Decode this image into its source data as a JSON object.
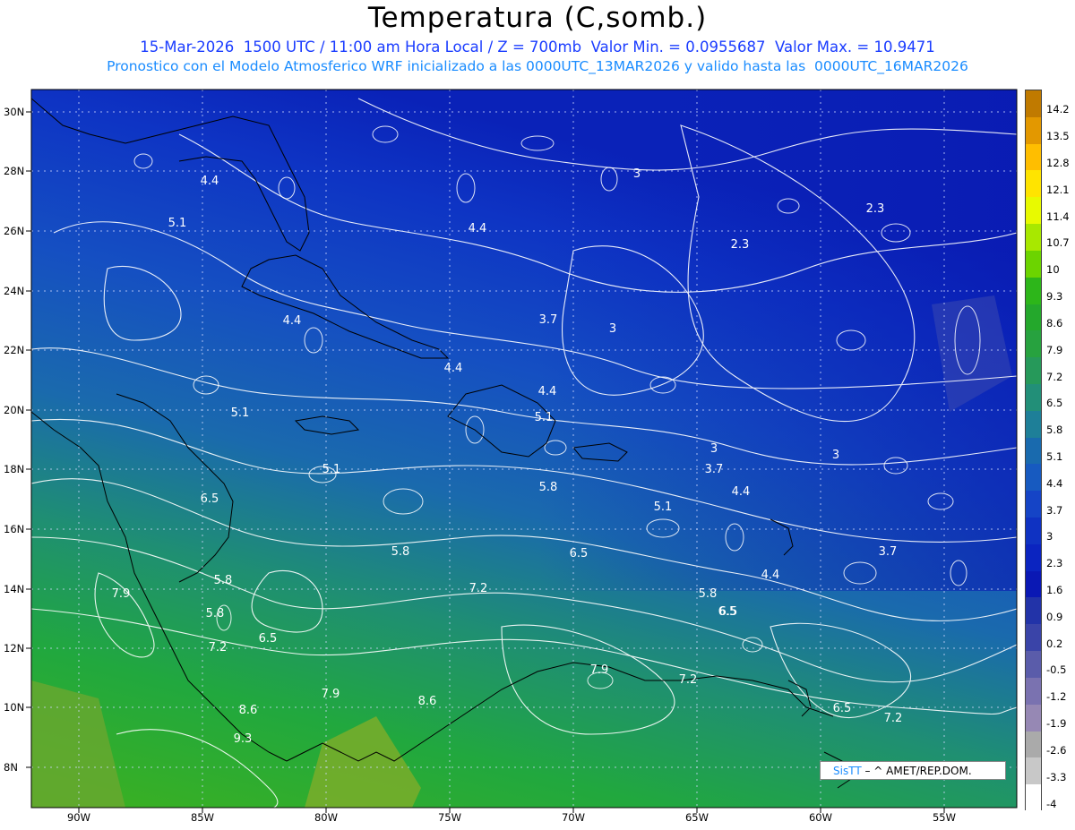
{
  "header": {
    "title": "Temperatura (C,somb.)",
    "subtitle_line1": "15-Mar-2026  1500 UTC / 11:00 am Hora Local / Z = 700mb  Valor Min. = 0.0955687  Valor Max. = 10.9471",
    "subtitle_line2": "Pronostico con el Modelo Atmosferico WRF inicializado a las 0000UTC_13MAR2026 y valido hasta las  0000UTC_16MAR2026"
  },
  "map": {
    "variable": "Temperatura",
    "units": "C",
    "level": "700mb",
    "valid_time": "15-Mar-2026 1500 UTC",
    "value_min": 0.0955687,
    "value_max": 10.9471,
    "lon_range": [
      -92.0,
      -52.5
    ],
    "lat_range": [
      6.8,
      30.5
    ],
    "lat_ticks": [
      "30N",
      "28N",
      "26N",
      "24N",
      "22N",
      "20N",
      "18N",
      "16N",
      "14N",
      "12N",
      "10N",
      "8N"
    ],
    "lon_ticks": [
      "90W",
      "85W",
      "80W",
      "75W",
      "70W",
      "65W",
      "60W",
      "55W"
    ],
    "contour_labels": [
      "4.4",
      "5.1",
      "4.4",
      "3",
      "2.3",
      "2.3",
      "4.4",
      "3.7",
      "3",
      "4.4",
      "4.4",
      "5.1",
      "5.1",
      "5.1",
      "3",
      "3.7",
      "4.4",
      "5.8",
      "6.5",
      "5.1",
      "3",
      "6.5",
      "5.8",
      "5.8",
      "6.5",
      "3.7",
      "4.4",
      "5.8",
      "7.9",
      "7.2",
      "5.8",
      "7.2",
      "6.5",
      "6.5",
      "7.9",
      "7.9",
      "8.6",
      "8.6",
      "7.2",
      "9.3",
      "7.2",
      "6.5",
      "7.9"
    ]
  },
  "colorbar": {
    "levels": [
      "14.2",
      "13.5",
      "12.8",
      "12.1",
      "11.4",
      "10.7",
      "10",
      "9.3",
      "8.6",
      "7.9",
      "7.2",
      "6.5",
      "5.8",
      "5.1",
      "4.4",
      "3.7",
      "3",
      "2.3",
      "1.6",
      "0.9",
      "0.2",
      "-0.5",
      "-1.2",
      "-1.9",
      "-2.6",
      "-3.3",
      "-4"
    ],
    "colors": [
      "#c07a00",
      "#e39800",
      "#ffbe00",
      "#ffe400",
      "#e8fa00",
      "#a8e800",
      "#6cd400",
      "#2db61a",
      "#24a82c",
      "#27a23f",
      "#26995a",
      "#228f78",
      "#1e7f98",
      "#196aae",
      "#175ac0",
      "#1544c6",
      "#0f32c2",
      "#0b24c0",
      "#0a18b4",
      "#2233a8",
      "#3a44a8",
      "#5a5caa",
      "#7a72b0",
      "#9688b4",
      "#aaaaaa",
      "#c8c8c8",
      "#ffffff"
    ]
  },
  "logo": {
    "brand": "SisTT",
    "text": "– ^ AMET/REP.DOM."
  }
}
